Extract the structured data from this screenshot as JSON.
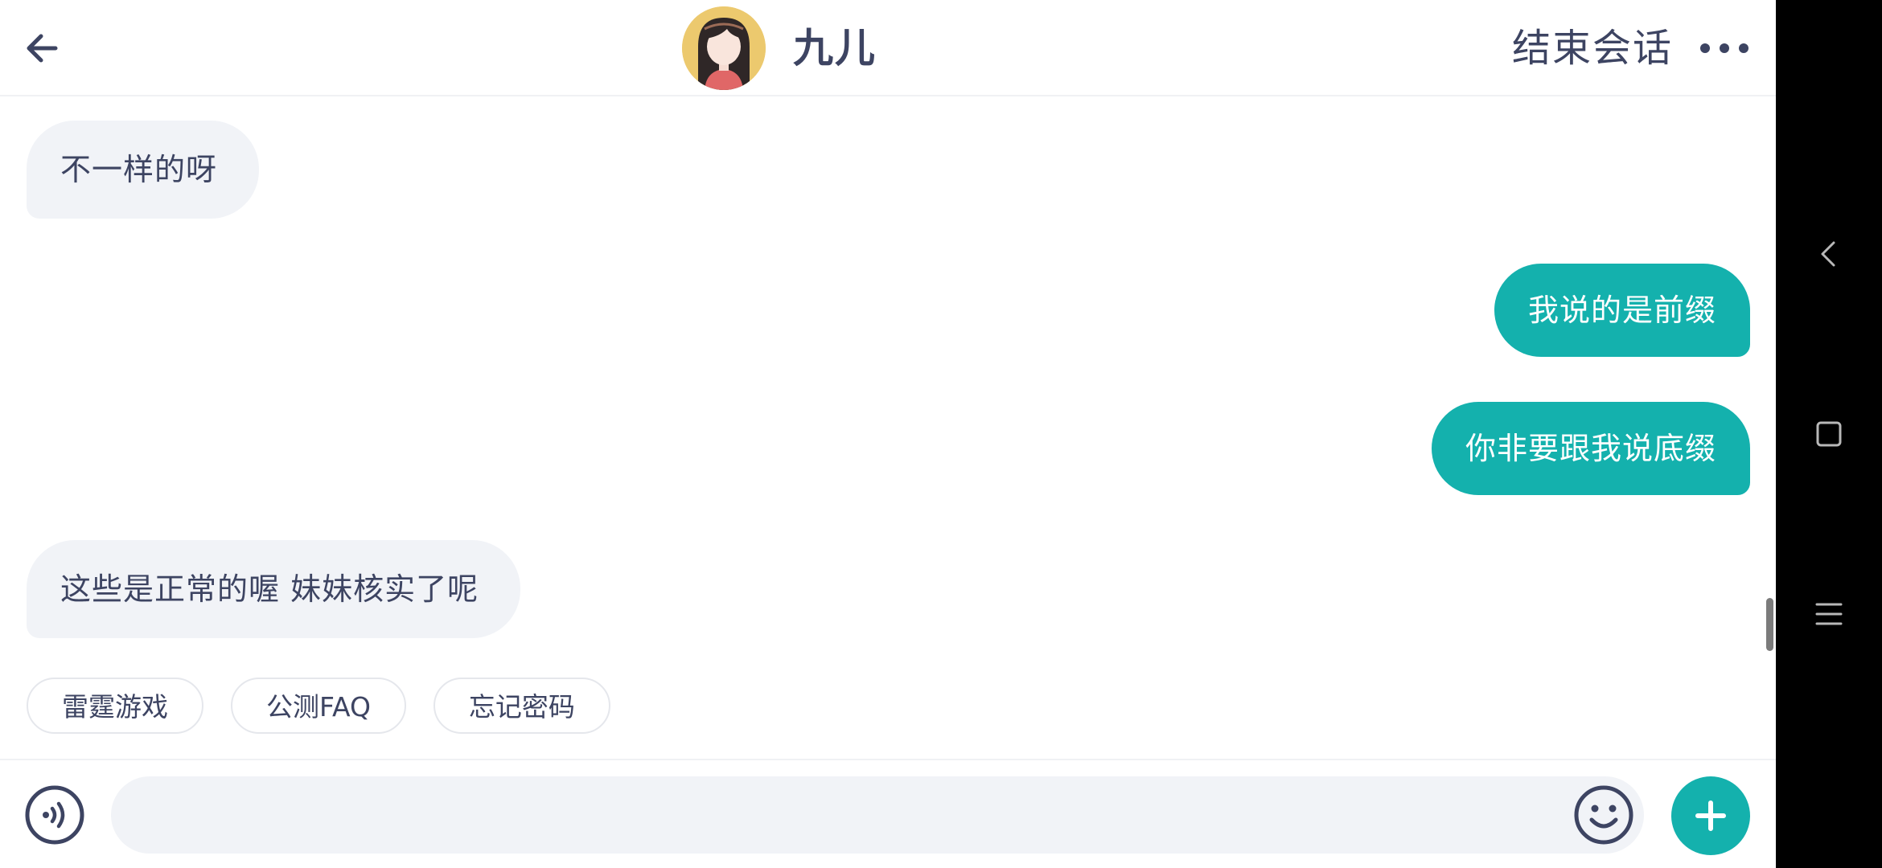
{
  "header": {
    "agent_name": "九儿",
    "end_session_label": "结束会话"
  },
  "messages": [
    {
      "side": "left",
      "text": "不一样的呀"
    },
    {
      "side": "right",
      "text": "我说的是前缀"
    },
    {
      "side": "right",
      "text": "你非要跟我说底缀"
    },
    {
      "side": "left",
      "text": "这些是正常的喔 妹妹核实了呢"
    }
  ],
  "quick_replies": [
    "雷霆游戏",
    "公测FAQ",
    "忘记密码"
  ],
  "input": {
    "value": "",
    "placeholder": ""
  },
  "colors": {
    "accent": "#14b1ad",
    "text": "#3d4462",
    "bubble_left_bg": "#f1f3f7",
    "avatar_bg": "#ecc96e",
    "system_nav_bg": "#000000"
  },
  "icons": {
    "back": "arrow-left-icon",
    "more": "more-dots-icon",
    "voice": "voice-icon",
    "emoji": "smiley-icon",
    "add": "plus-icon",
    "system_back": "chevron-left-icon",
    "system_home": "square-icon",
    "system_menu": "menu-lines-icon"
  }
}
